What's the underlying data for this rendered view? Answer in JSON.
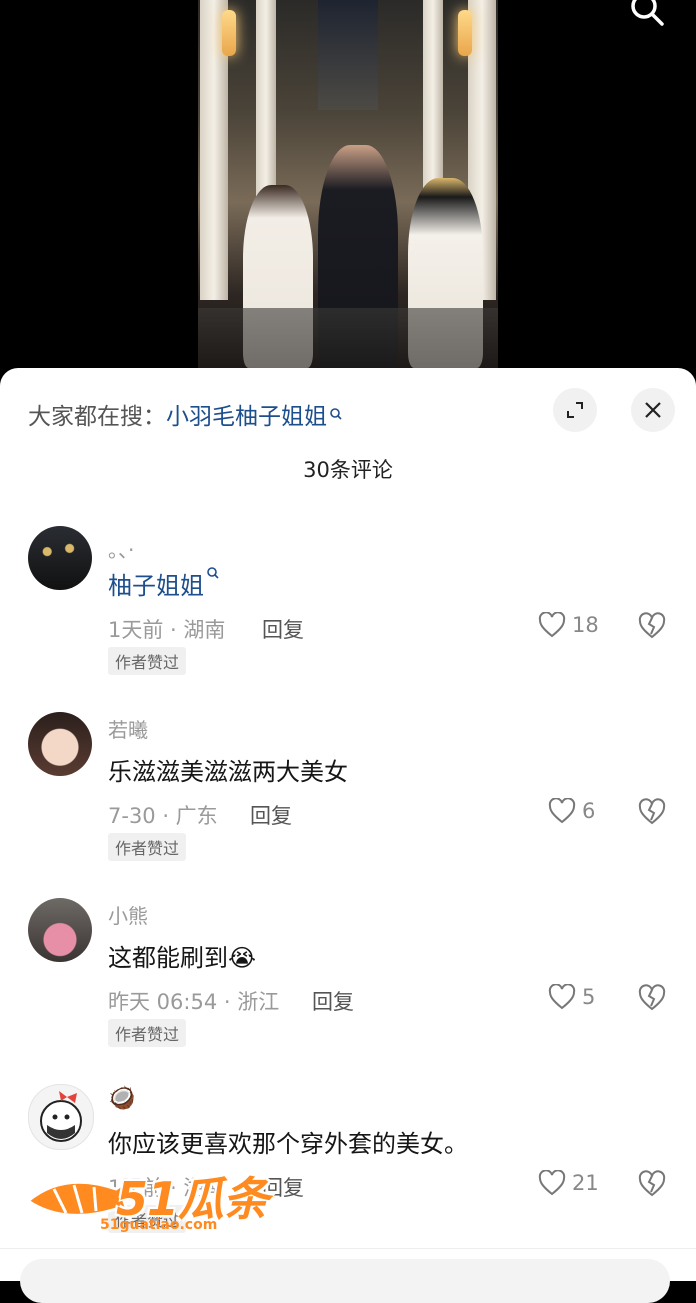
{
  "search_hint": {
    "prefix": "大家都在搜：",
    "term": "小羽毛柚子姐姐"
  },
  "comments_count": "30条评论",
  "comments": [
    {
      "user": "。、·",
      "text": "柚子姐姐",
      "time_loc": "1天前 · 湖南",
      "reply": "回复",
      "badge": "作者赞过",
      "likes": "18"
    },
    {
      "user": "若曦",
      "text": "乐滋滋美滋滋两大美女",
      "time_loc": "7-30 · 广东",
      "reply": "回复",
      "badge": "作者赞过",
      "likes": "6"
    },
    {
      "user": "小熊",
      "text": "这都能刷到😭",
      "time_loc": "昨天 06:54 · 浙江",
      "reply": "回复",
      "badge": "作者赞过",
      "likes": "5"
    },
    {
      "user": "🥥",
      "text": "你应该更喜欢那个穿外套的美女。",
      "time_loc": "1天前 · 湖南",
      "reply": "回复",
      "badge": "作者赞过",
      "likes": "21"
    }
  ],
  "watermark": {
    "brand": "51瓜条",
    "url": "51guatiao.com"
  },
  "colors": {
    "link": "#1d4f8c",
    "watermark": "#ff8a1f"
  }
}
